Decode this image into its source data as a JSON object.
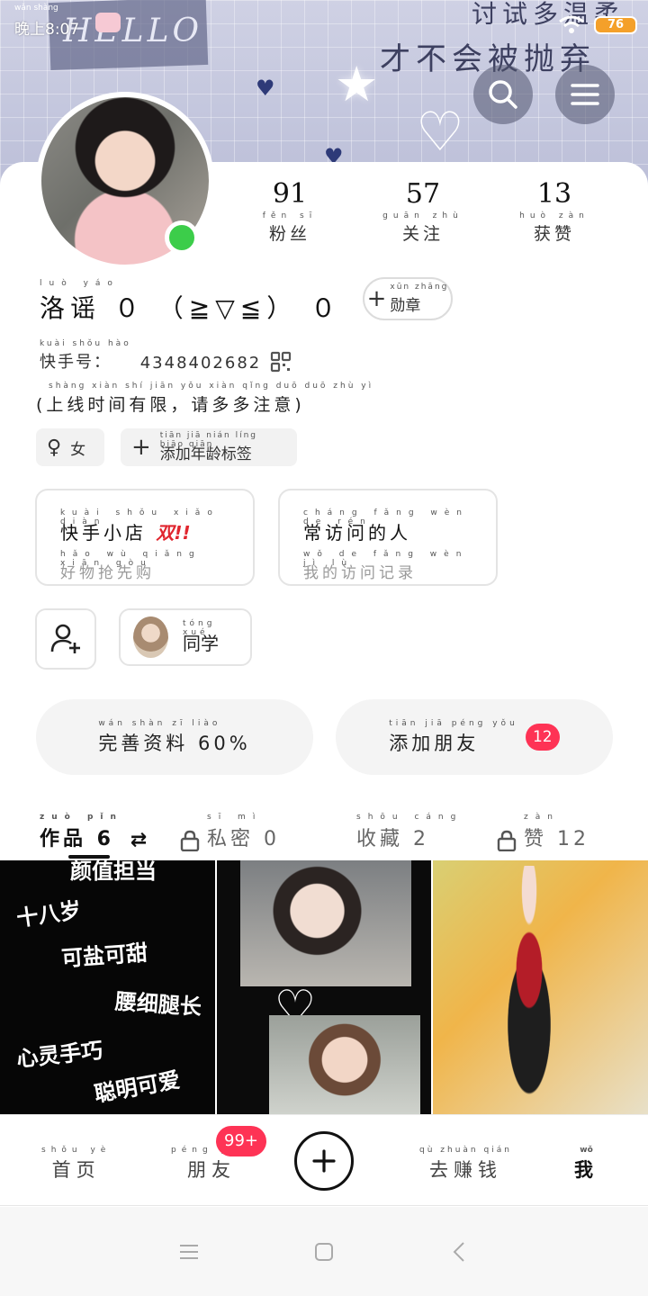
{
  "status_bar": {
    "time_pinyin": "wǎn shàng",
    "time": "晚上8:07",
    "battery": "76"
  },
  "banner": {
    "deco_text_1": "HELLO",
    "deco_text_2": "讨试多温柔",
    "deco_text_3": "才不会被抛弃"
  },
  "profile": {
    "stats": [
      {
        "value": "91",
        "label_pinyin": "fěn sī",
        "label": "粉丝"
      },
      {
        "value": "57",
        "label_pinyin": "guān zhù",
        "label": "关注"
      },
      {
        "value": "13",
        "label_pinyin": "huò zàn",
        "label": "获赞"
      }
    ],
    "nickname_pinyin": "luò yáo",
    "nickname": "洛谣 ０ （≧▽≦） ０",
    "medal_pinyin": "xūn zhāng",
    "medal_label": "勋章",
    "uid_pinyin": "kuài shǒu hào",
    "uid_label": "快手号：",
    "uid_value": "4348402682",
    "bio_pinyin": "shàng xiàn shí jiān yǒu xiàn   qǐng duō duō zhù yì",
    "bio": "(上线时间有限，请多多注意)",
    "gender_symbol": "♀",
    "gender_label": "女",
    "age_tag_pinyin": "tiān jiā nián líng biāo qiān",
    "age_tag": "添加年龄标签"
  },
  "features": {
    "shop_title_pinyin": "kuài shǒu xiǎo diàn",
    "shop_title": "快手小店",
    "shop_hot": "双!!",
    "shop_sub_pinyin": "hǎo wù qiǎng xiān gòu",
    "shop_sub": "好物抢先购",
    "visitors_title_pinyin": "cháng fǎng wèn de rén",
    "visitors_title": "常访问的人",
    "visitors_sub_pinyin": "wǒ de fǎng wèn jì lù",
    "visitors_sub": "我的访问记录",
    "classmate_pinyin": "tóng xué",
    "classmate_label": "同学"
  },
  "actions": {
    "complete_pinyin": "wán shàn zī liào",
    "complete_label": "完善资料 60%",
    "add_friends_pinyin": "tiān jiā péng yǒu",
    "add_friends_label": "添加朋友",
    "add_friends_count": "12"
  },
  "tabs": [
    {
      "pinyin": "zuò pǐn",
      "label": "作品 6"
    },
    {
      "pinyin": "sī mì",
      "label": "私密 0"
    },
    {
      "pinyin": "shōu cáng",
      "label": "收藏 2"
    },
    {
      "pinyin": "zàn",
      "label": "赞 12"
    }
  ],
  "videos": {
    "v1_lines": [
      "颜值担当",
      "十八岁",
      "可盐可甜",
      "腰细腿长",
      "心灵手巧",
      "聪明可爱"
    ]
  },
  "bottom_nav": {
    "home_pinyin": "shǒu yè",
    "home": "首页",
    "friends_pinyin": "péng yǒu",
    "friends": "朋友",
    "friends_badge": "99+",
    "earn_pinyin": "qù zhuàn qián",
    "earn": "去赚钱",
    "me_pinyin": "wǒ",
    "me": "我"
  },
  "colors": {
    "accent_red": "#fe3355",
    "online_green": "#3ccd4a",
    "battery_orange": "#f4a02a"
  }
}
